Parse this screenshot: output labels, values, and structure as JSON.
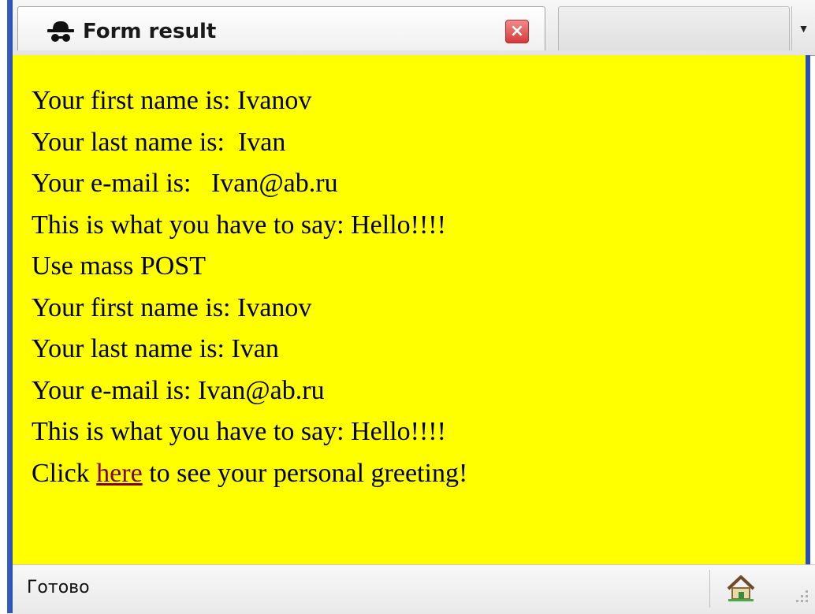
{
  "window": {
    "tab_title": "Form result",
    "tab_icon": "spy-hat-icon",
    "close_icon": "close-icon",
    "dropdown_icon": "chevron-down-icon"
  },
  "content": {
    "background_color": "#ffff00",
    "lines": [
      "Your first name is: Ivanov",
      "Your last name is:  Ivan",
      "Your e-mail is:   Ivan@ab.ru",
      "This is what you have to say: Hello!!!!",
      "Use mass POST",
      "Your first name is: Ivanov",
      "Your last name is: Ivan",
      "Your e-mail is: Ivan@ab.ru",
      "This is what you have to say: Hello!!!!"
    ],
    "greeting": {
      "prefix": "Click ",
      "link_text": "here",
      "suffix": " to see your personal greeting!"
    }
  },
  "statusbar": {
    "status_text": "Готово",
    "home_icon": "home-icon"
  }
}
